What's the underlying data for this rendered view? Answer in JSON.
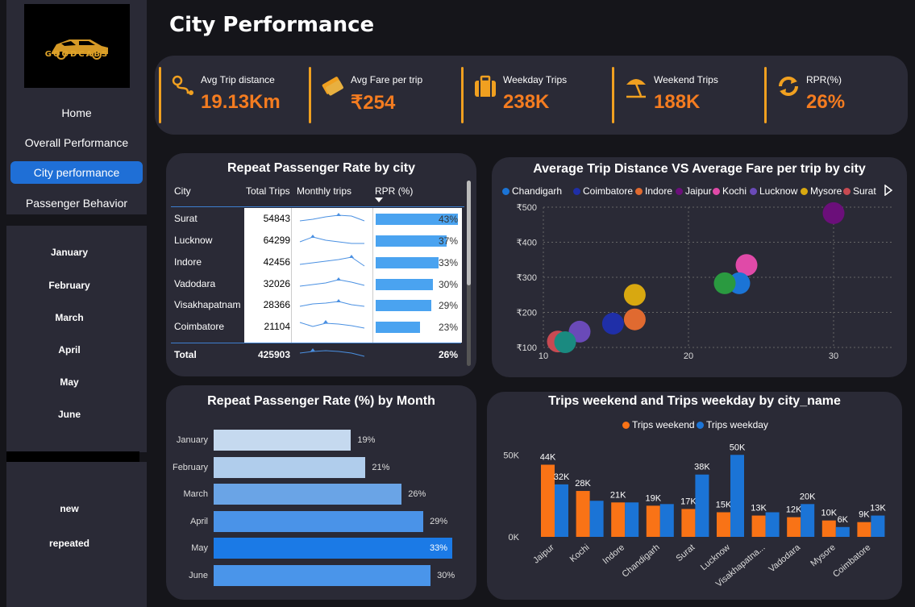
{
  "brand": "GOODCABS",
  "page_title": "City Performance",
  "nav": [
    "Home",
    "Overall Performance",
    "City performance",
    "Passenger Behavior"
  ],
  "months": [
    "January",
    "February",
    "March",
    "April",
    "May",
    "June"
  ],
  "passenger_types": [
    "new",
    "repeated"
  ],
  "kpis": [
    {
      "label": "Avg Trip distance",
      "value": "19.13Km",
      "icon": "route-icon"
    },
    {
      "label": "Avg Fare per trip",
      "value": "₹254",
      "icon": "ticket-icon"
    },
    {
      "label": "Weekday Trips",
      "value": "238K",
      "icon": "suitcase-icon"
    },
    {
      "label": "Weekend Trips",
      "value": "188K",
      "icon": "beach-umbrella-icon"
    },
    {
      "label": "RPR(%)",
      "value": "26%",
      "icon": "refresh-icon"
    }
  ],
  "colors": {
    "accent": "#f47c20",
    "kpi_bar": "#f0a020",
    "weekend": "#f97316",
    "weekday": "#1b74d6",
    "nav_active": "#1f6fd6"
  },
  "rpr_table": {
    "title": "Repeat Passenger Rate by city",
    "headers": [
      "City",
      "Total Trips",
      "Monthly trips",
      "RPR (%)"
    ],
    "rows": [
      {
        "city": "Surat",
        "trips": "54843",
        "rpr": "43%",
        "rpr_value": 43
      },
      {
        "city": "Lucknow",
        "trips": "64299",
        "rpr": "37%",
        "rpr_value": 37
      },
      {
        "city": "Indore",
        "trips": "42456",
        "rpr": "33%",
        "rpr_value": 33
      },
      {
        "city": "Vadodara",
        "trips": "32026",
        "rpr": "30%",
        "rpr_value": 30
      },
      {
        "city": "Visakhapatnam",
        "trips": "28366",
        "rpr": "29%",
        "rpr_value": 29
      },
      {
        "city": "Coimbatore",
        "trips": "21104",
        "rpr": "23%",
        "rpr_value": 23
      }
    ],
    "total": {
      "label": "Total",
      "trips": "425903",
      "rpr": "26%"
    }
  },
  "chart_data": [
    {
      "type": "scatter",
      "title": "Average Trip Distance VS Average Fare per trip by city",
      "xlim": [
        10,
        34
      ],
      "ylim": [
        100,
        500
      ],
      "x_ticks": [
        "10",
        "20",
        "30"
      ],
      "y_ticks": [
        "₹500",
        "₹400",
        "₹300",
        "₹200",
        "₹100"
      ],
      "legend": [
        {
          "name": "Chandigarh",
          "color": "#1b74d6"
        },
        {
          "name": "Coimbatore",
          "color": "#1f2fa8"
        },
        {
          "name": "Indore",
          "color": "#e06a30"
        },
        {
          "name": "Jaipur",
          "color": "#6b0f7a"
        },
        {
          "name": "Kochi",
          "color": "#e04aa8"
        },
        {
          "name": "Lucknow",
          "color": "#6a4ab8"
        },
        {
          "name": "Mysore",
          "color": "#d8a810"
        },
        {
          "name": "Surat",
          "color": "#c84a52"
        }
      ],
      "points": [
        {
          "city": "Jaipur",
          "x": 30.0,
          "y": 483,
          "color": "#6b0f7a"
        },
        {
          "city": "Kochi",
          "x": 24.0,
          "y": 335,
          "color": "#e04aa8"
        },
        {
          "city": "Chandigarh",
          "x": 23.5,
          "y": 283,
          "color": "#1b74d6"
        },
        {
          "city": "Visakhapatnam",
          "x": 22.5,
          "y": 283,
          "color": "#2a9a40"
        },
        {
          "city": "Mysore",
          "x": 16.3,
          "y": 250,
          "color": "#d8a810"
        },
        {
          "city": "Indore",
          "x": 16.3,
          "y": 180,
          "color": "#e06a30"
        },
        {
          "city": "Coimbatore",
          "x": 14.8,
          "y": 168,
          "color": "#1f2fa8"
        },
        {
          "city": "Lucknow",
          "x": 12.5,
          "y": 145,
          "color": "#6a4ab8"
        },
        {
          "city": "Surat",
          "x": 11.0,
          "y": 117,
          "color": "#c84a52"
        },
        {
          "city": "Vadodara",
          "x": 11.5,
          "y": 115,
          "color": "#1a8a80"
        }
      ]
    },
    {
      "type": "bar",
      "orientation": "horizontal",
      "title": "Repeat Passenger Rate (%) by Month",
      "categories": [
        "January",
        "February",
        "March",
        "April",
        "May",
        "June"
      ],
      "values": [
        19,
        21,
        26,
        29,
        33,
        30
      ],
      "labels": [
        "19%",
        "21%",
        "26%",
        "29%",
        "33%",
        "30%"
      ],
      "colors": [
        "#c5d9ef",
        "#b0cdec",
        "#6aa4e6",
        "#4a93e8",
        "#1b7ae6",
        "#4a95ea"
      ]
    },
    {
      "type": "bar",
      "title": "Trips weekend and Trips weekday by city_name",
      "categories": [
        "Jaipur",
        "Kochi",
        "Indore",
        "Chandigarh",
        "Surat",
        "Lucknow",
        "Visakhapatna...",
        "Vadodara",
        "Mysore",
        "Coimbatore"
      ],
      "y_ticks": [
        "50K",
        "0K"
      ],
      "ylim": [
        0,
        58
      ],
      "series": [
        {
          "name": "Trips weekend",
          "color": "#f97316",
          "values": [
            44,
            28,
            21,
            19,
            17,
            15,
            13,
            12,
            10,
            9
          ],
          "labels": [
            "44K",
            "28K",
            "21K",
            "19K",
            "17K",
            "15K",
            "13K",
            "12K",
            "10K",
            "9K"
          ]
        },
        {
          "name": "Trips weekday",
          "color": "#1b74d6",
          "values": [
            32,
            22,
            21,
            20,
            38,
            50,
            15,
            20,
            6,
            13
          ],
          "labels": [
            "32K",
            "",
            "",
            "",
            "38K",
            "50K",
            "",
            "20K",
            "6K",
            "13K"
          ]
        }
      ]
    }
  ]
}
